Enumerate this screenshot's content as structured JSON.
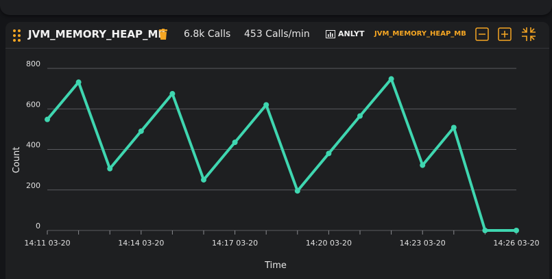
{
  "panel": {
    "metric_name": "JVM_MEMORY_HEAP_MB",
    "calls": "6.8k Calls",
    "rate": "453 Calls/min",
    "anlyt_label": "ANLYT",
    "metric_tag": "JVM_MEMORY_HEAP_MB"
  },
  "colors": {
    "accent": "#f5a623",
    "line": "#3fd6b0",
    "grid": "#5a5b60",
    "background": "#1e1f21"
  },
  "chart_data": {
    "type": "line",
    "title": "",
    "xlabel": "Time",
    "ylabel": "Count",
    "ylim": [
      0,
      800
    ],
    "yticks": [
      0,
      200,
      400,
      600,
      800
    ],
    "x_tick_labels": [
      "14:11 03-20",
      "14:14 03-20",
      "14:17 03-20",
      "14:20 03-20",
      "14:23 03-20",
      "14:26 03-20"
    ],
    "x_tick_positions": [
      0,
      3,
      6,
      9,
      12,
      15
    ],
    "x": [
      "14:11",
      "14:12",
      "14:13",
      "14:14",
      "14:15",
      "14:16",
      "14:17",
      "14:18",
      "14:19",
      "14:20",
      "14:21",
      "14:22",
      "14:23",
      "14:24",
      "14:25",
      "14:26"
    ],
    "series": [
      {
        "values": [
          548,
          732,
          305,
          490,
          675,
          250,
          435,
          620,
          195,
          380,
          565,
          748,
          322,
          508,
          0,
          0
        ]
      }
    ],
    "grid": true,
    "legend": "none"
  }
}
